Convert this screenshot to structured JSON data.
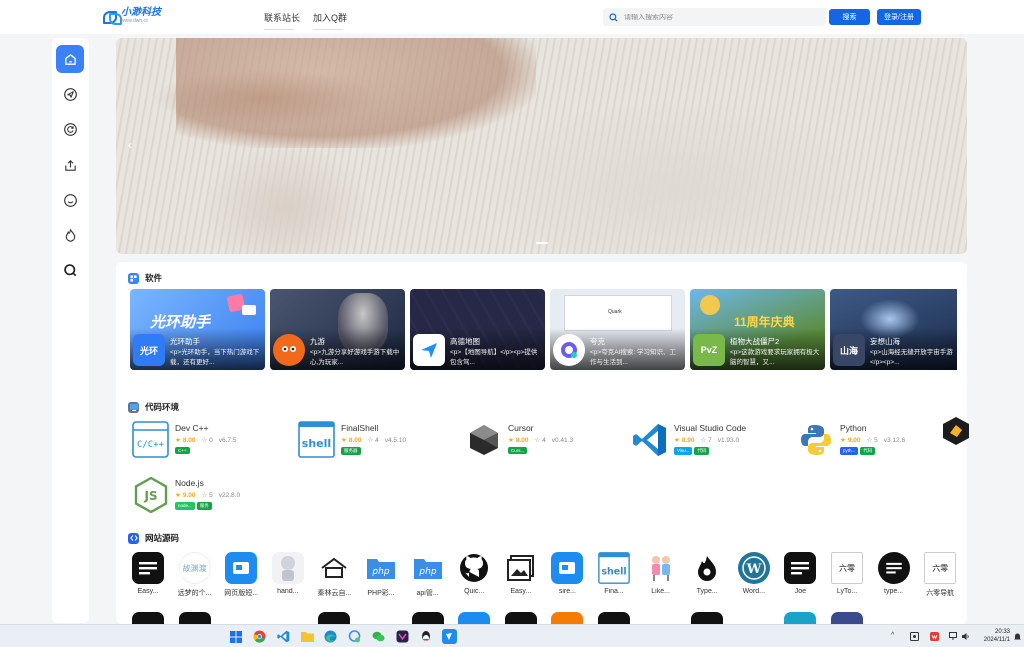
{
  "header": {
    "logo_name": "小渺科技",
    "logo_url": "www.dwn.cc",
    "nav": [
      "联系站长",
      "加入Q群"
    ],
    "search_placeholder": "请输入搜索内容",
    "search_button": "搜索",
    "login_button": "登录/注册"
  },
  "sidebar": {
    "items": [
      "home-icon",
      "send-icon",
      "refresh-icon",
      "upload-icon",
      "smile-icon",
      "fire-icon",
      "search-icon"
    ],
    "accent": "#3b82f6"
  },
  "software": {
    "title": "软件",
    "cards": [
      {
        "name": "光环助手",
        "desc": "<p>光环助手，当下热门游戏下载，还有更好...",
        "color": "#3a8ef0"
      },
      {
        "name": "九游",
        "desc": "<p>九游分享好游戏手游下载中心,为玩家...",
        "color": "#1e2a44"
      },
      {
        "name": "高德地图",
        "desc": "<p>【地图导航】</p><p>提供包含驾...",
        "color": "#20213a"
      },
      {
        "name": "夸克",
        "desc": "<p>夸克AI搜索: 学习知识、工作与生活到...",
        "color": "#e4e7ee"
      },
      {
        "name": "植物大战僵尸2",
        "desc": "<p>这款游戏要求玩家拥有极大脑的智慧，又...",
        "color": "#5b8d3c"
      },
      {
        "name": "妄想山海",
        "desc": "<p>山海经无缝开放宇宙手游</p><p>...",
        "color": "#2b3a5c"
      }
    ]
  },
  "code_env": {
    "title": "代码环境",
    "items": [
      {
        "name": "Dev C++",
        "rating": "8.00",
        "likes": "0",
        "version": "v6.7.5",
        "tags": [
          "C++"
        ]
      },
      {
        "name": "FinalShell",
        "rating": "8.00",
        "likes": "4",
        "version": "v4.5.10",
        "tags": [
          "服务器"
        ]
      },
      {
        "name": "Cursor",
        "rating": "8.00",
        "likes": "4",
        "version": "v0.41.3",
        "tags": [
          "Curs..."
        ]
      },
      {
        "name": "Visual Studio Code",
        "rating": "8.90",
        "likes": "7",
        "version": "v1.93.0",
        "tags": [
          "Visu...",
          "代码"
        ]
      },
      {
        "name": "Python",
        "rating": "9.00",
        "likes": "5",
        "version": "v3.12.6",
        "tags": [
          "pyth...",
          "代码"
        ]
      },
      {
        "name": "Node.js",
        "rating": "9.00",
        "likes": "5",
        "version": "v22.8.0",
        "tags": [
          "node...",
          "服务"
        ]
      }
    ]
  },
  "source": {
    "title": "网站源码",
    "items": [
      "Easy...",
      "远梦的个...",
      "网页版短...",
      "hand...",
      "秦林云自...",
      "PHP彩...",
      "api管...",
      "Quic...",
      "Easy...",
      "sire...",
      "Fina...",
      "Like...",
      "Type...",
      "Word...",
      "Joe",
      "LyTo...",
      "type...",
      "六零导航"
    ]
  },
  "taskbar": {
    "time": "20:33",
    "date": "2024/11/1"
  }
}
